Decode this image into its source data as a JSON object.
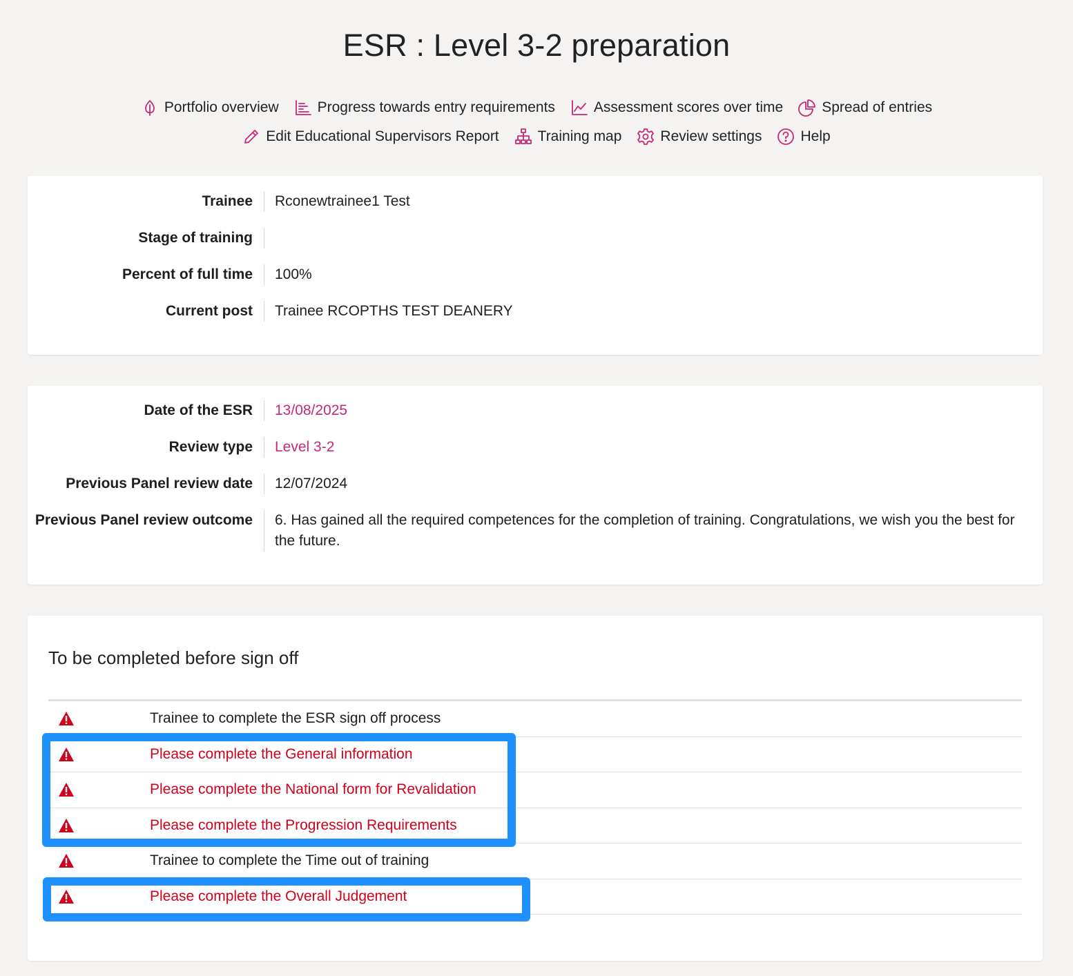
{
  "page": {
    "title": "ESR : Level 3-2 preparation"
  },
  "nav": {
    "row1": [
      {
        "label": "Portfolio overview",
        "icon": "leaf-icon"
      },
      {
        "label": "Progress towards entry requirements",
        "icon": "bar-list-icon"
      },
      {
        "label": "Assessment scores over time",
        "icon": "line-chart-icon"
      },
      {
        "label": "Spread of entries",
        "icon": "pie-chart-icon"
      }
    ],
    "row2": [
      {
        "label": "Edit Educational Supervisors Report",
        "icon": "pencil-icon"
      },
      {
        "label": "Training map",
        "icon": "sitemap-icon"
      },
      {
        "label": "Review settings",
        "icon": "gear-icon"
      },
      {
        "label": "Help",
        "icon": "help-circle-icon"
      }
    ]
  },
  "trainee_card": {
    "rows": [
      {
        "label": "Trainee",
        "value": "Rconewtrainee1 Test"
      },
      {
        "label": "Stage of training",
        "value": ""
      },
      {
        "label": "Percent of full time",
        "value": "100%"
      },
      {
        "label": "Current post",
        "value": "Trainee RCOPTHS TEST DEANERY"
      }
    ]
  },
  "review_card": {
    "rows": [
      {
        "label": "Date of the ESR",
        "value": "13/08/2025"
      },
      {
        "label": "Review type",
        "value": "Level 3-2"
      },
      {
        "label": "Previous Panel review date",
        "value": "12/07/2024"
      },
      {
        "label": "Previous Panel review outcome",
        "value": "6. Has gained all the required competences for the completion of training. Congratulations, we wish you the best for the future."
      }
    ]
  },
  "signoff": {
    "title": "To be completed before sign off",
    "items": [
      {
        "text": "Trainee to complete the ESR sign off process",
        "icon": "warning-icon"
      },
      {
        "text": "Please complete the General information",
        "icon": "warning-icon"
      },
      {
        "text": "Please complete the National form for Revalidation",
        "icon": "warning-icon"
      },
      {
        "text": "Please complete the Progression Requirements",
        "icon": "warning-icon"
      },
      {
        "text": "Trainee to complete the Time out of training",
        "icon": "warning-icon"
      },
      {
        "text": "Please complete the Overall Judgement",
        "icon": "warning-icon"
      }
    ]
  },
  "colors": {
    "accent": "#c4287a",
    "warning": "#d0021b",
    "highlight": "#1e90ff"
  }
}
